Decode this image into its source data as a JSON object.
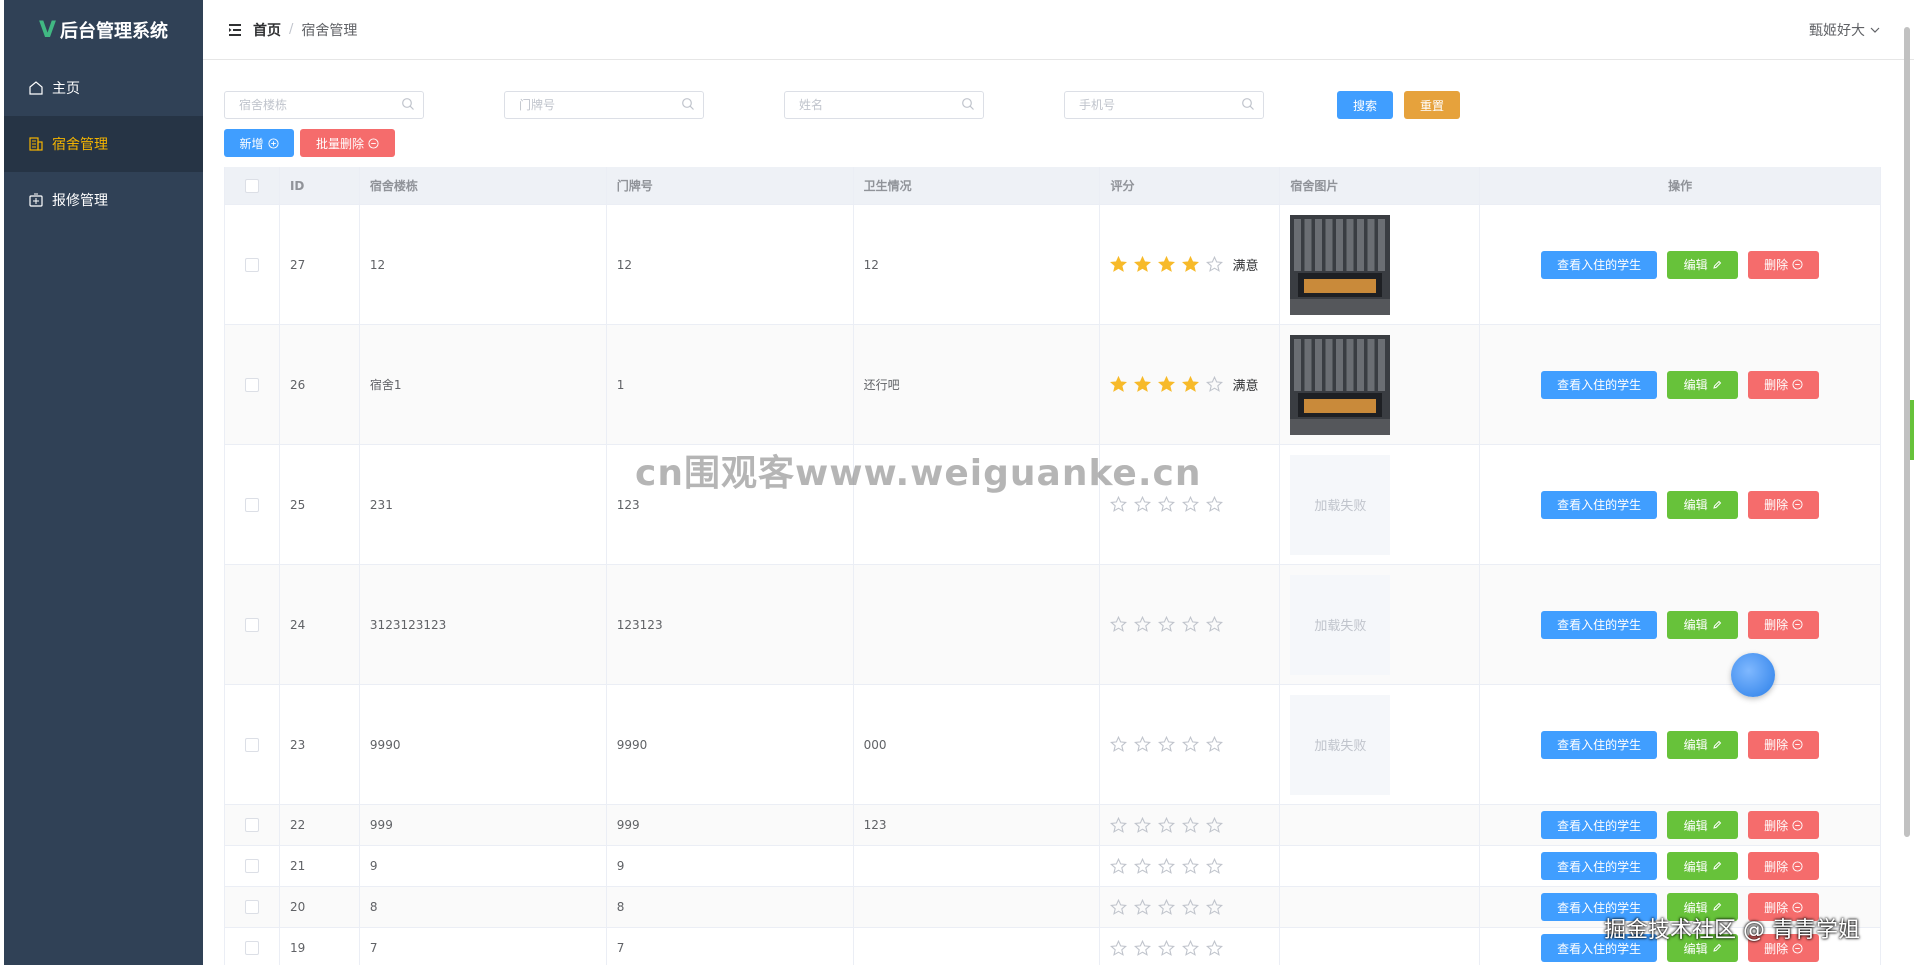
{
  "app": {
    "title": "后台管理系统",
    "logo_letter": "V"
  },
  "sidebar": {
    "items": [
      {
        "label": "主页",
        "icon": "home-icon"
      },
      {
        "label": "宿舍管理",
        "icon": "building-icon",
        "active": true
      },
      {
        "label": "报修管理",
        "icon": "repair-icon"
      }
    ]
  },
  "header": {
    "breadcrumb_home": "首页",
    "breadcrumb_sep": "/",
    "breadcrumb_current": "宿舍管理",
    "user_name": "甄姬好大"
  },
  "filters": {
    "building_placeholder": "宿舍楼栋",
    "door_placeholder": "门牌号",
    "name_placeholder": "姓名",
    "phone_placeholder": "手机号",
    "search_label": "搜索",
    "reset_label": "重置",
    "add_label": "新增",
    "batch_delete_label": "批量删除"
  },
  "table": {
    "headers": [
      "ID",
      "宿舍楼栋",
      "门牌号",
      "卫生情况",
      "评分",
      "宿舍图片",
      "操作"
    ],
    "view_label": "查看入住的学生",
    "edit_label": "编辑",
    "delete_label": "删除",
    "image_fail_text": "加载失败",
    "rows": [
      {
        "id": "27",
        "building": "12",
        "door": "12",
        "hygiene": "12",
        "rating": 4,
        "rating_text": "满意",
        "image": "photo"
      },
      {
        "id": "26",
        "building": "宿舍1",
        "door": "1",
        "hygiene": "还行吧",
        "rating": 4,
        "rating_text": "满意",
        "image": "photo"
      },
      {
        "id": "25",
        "building": "231",
        "door": "123",
        "hygiene": "",
        "rating": 0,
        "rating_text": "",
        "image": "fail"
      },
      {
        "id": "24",
        "building": "3123123123",
        "door": "123123",
        "hygiene": "",
        "rating": 0,
        "rating_text": "",
        "image": "fail"
      },
      {
        "id": "23",
        "building": "9990",
        "door": "9990",
        "hygiene": "000",
        "rating": 0,
        "rating_text": "",
        "image": "fail"
      },
      {
        "id": "22",
        "building": "999",
        "door": "999",
        "hygiene": "123",
        "rating": 0,
        "rating_text": "",
        "image": "none"
      },
      {
        "id": "21",
        "building": "9",
        "door": "9",
        "hygiene": "",
        "rating": 0,
        "rating_text": "",
        "image": "none"
      },
      {
        "id": "20",
        "building": "8",
        "door": "8",
        "hygiene": "",
        "rating": 0,
        "rating_text": "",
        "image": "none"
      },
      {
        "id": "19",
        "building": "7",
        "door": "7",
        "hygiene": "",
        "rating": 0,
        "rating_text": "",
        "image": "none"
      }
    ]
  },
  "watermarks": {
    "center": "cn围观客www.weiguanke.cn",
    "corner": "掘金技术社区 @ 青青学姐"
  },
  "colors": {
    "sidebar": "#304156",
    "primary": "#409eff",
    "success": "#67c23a",
    "danger": "#f56c6c",
    "warning": "#e6a23c",
    "star": "#f7ba2a"
  }
}
